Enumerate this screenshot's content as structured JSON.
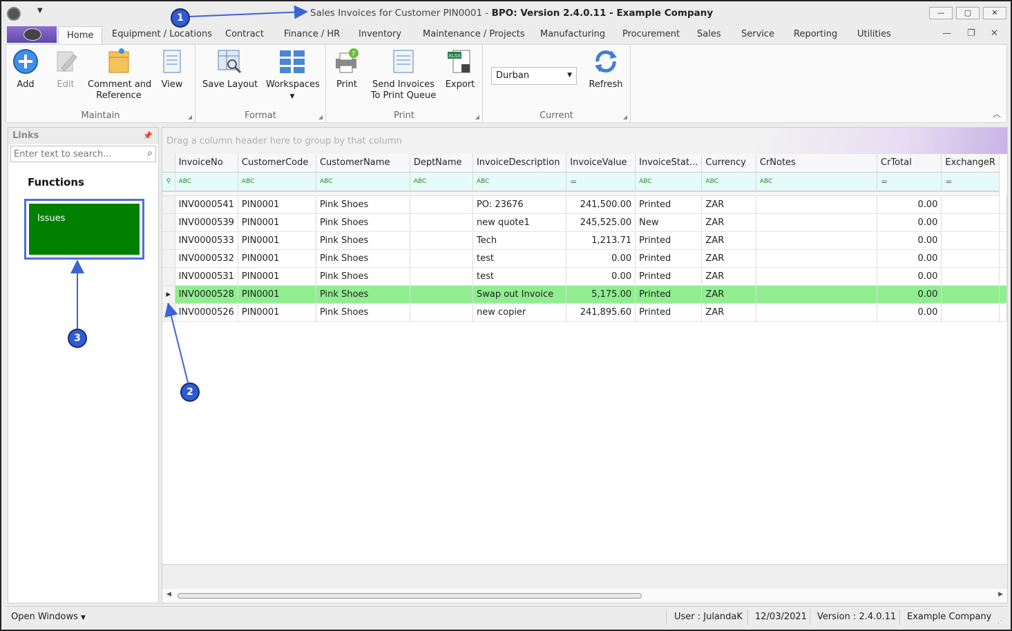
{
  "window": {
    "title_prefix": "Sales Invoices for Customer PIN0001 - ",
    "title_bold": "BPO: Version 2.4.0.11 - Example Company",
    "controls": [
      "—",
      "▢",
      "✕"
    ]
  },
  "tabs": [
    "Home",
    "Equipment / Locations",
    "Contract",
    "Finance / HR",
    "Inventory",
    "Maintenance / Projects",
    "Manufacturing",
    "Procurement",
    "Sales",
    "Service",
    "Reporting",
    "Utilities"
  ],
  "ribbon": {
    "maintain": {
      "label": "Maintain",
      "add": "Add",
      "edit": "Edit",
      "comment_1": "Comment and",
      "comment_2": "Reference",
      "view": "View"
    },
    "format": {
      "label": "Format",
      "save_layout": "Save Layout",
      "workspaces": "Workspaces"
    },
    "print": {
      "label": "Print",
      "print": "Print",
      "send_1": "Send Invoices",
      "send_2": "To Print Queue",
      "export": "Export"
    },
    "current": {
      "label": "Current",
      "site": "Durban",
      "refresh": "Refresh"
    }
  },
  "links": {
    "title": "Links",
    "search_placeholder": "Enter text to search...",
    "functions_title": "Functions",
    "issues_label": "Issues"
  },
  "grid": {
    "group_hint": "Drag a column header here to group by that column",
    "columns": [
      "InvoiceNo",
      "CustomerCode",
      "CustomerName",
      "DeptName",
      "InvoiceDescription",
      "InvoiceValue",
      "InvoiceStat...",
      "Currency",
      "CrNotes",
      "CrTotal",
      "ExchangeR"
    ],
    "rows": [
      {
        "InvoiceNo": "INV0000541",
        "CustomerCode": "PIN0001",
        "CustomerName": "Pink Shoes",
        "DeptName": "",
        "InvoiceDescription": "PO: 23676",
        "InvoiceValue": "241,500.00",
        "InvoiceStatus": "Printed",
        "Currency": "ZAR",
        "CrNotes": "",
        "CrTotal": "0.00",
        "Exchange": ""
      },
      {
        "InvoiceNo": "INV0000539",
        "CustomerCode": "PIN0001",
        "CustomerName": "Pink Shoes",
        "DeptName": "",
        "InvoiceDescription": "new quote1",
        "InvoiceValue": "245,525.00",
        "InvoiceStatus": "New",
        "Currency": "ZAR",
        "CrNotes": "",
        "CrTotal": "0.00",
        "Exchange": ""
      },
      {
        "InvoiceNo": "INV0000533",
        "CustomerCode": "PIN0001",
        "CustomerName": "Pink Shoes",
        "DeptName": "",
        "InvoiceDescription": "Tech",
        "InvoiceValue": "1,213.71",
        "InvoiceStatus": "Printed",
        "Currency": "ZAR",
        "CrNotes": "",
        "CrTotal": "0.00",
        "Exchange": ""
      },
      {
        "InvoiceNo": "INV0000532",
        "CustomerCode": "PIN0001",
        "CustomerName": "Pink Shoes",
        "DeptName": "",
        "InvoiceDescription": "test",
        "InvoiceValue": "0.00",
        "InvoiceStatus": "Printed",
        "Currency": "ZAR",
        "CrNotes": "",
        "CrTotal": "0.00",
        "Exchange": ""
      },
      {
        "InvoiceNo": "INV0000531",
        "CustomerCode": "PIN0001",
        "CustomerName": "Pink Shoes",
        "DeptName": "",
        "InvoiceDescription": "test",
        "InvoiceValue": "0.00",
        "InvoiceStatus": "Printed",
        "Currency": "ZAR",
        "CrNotes": "",
        "CrTotal": "0.00",
        "Exchange": ""
      },
      {
        "InvoiceNo": "INV0000528",
        "CustomerCode": "PIN0001",
        "CustomerName": "Pink Shoes",
        "DeptName": "",
        "InvoiceDescription": "Swap out Invoice",
        "InvoiceValue": "5,175.00",
        "InvoiceStatus": "Printed",
        "Currency": "ZAR",
        "CrNotes": "",
        "CrTotal": "0.00",
        "Exchange": ""
      },
      {
        "InvoiceNo": "INV0000526",
        "CustomerCode": "PIN0001",
        "CustomerName": "Pink Shoes",
        "DeptName": "",
        "InvoiceDescription": "new copier",
        "InvoiceValue": "241,895.60",
        "InvoiceStatus": "Printed",
        "Currency": "ZAR",
        "CrNotes": "",
        "CrTotal": "0.00",
        "Exchange": ""
      }
    ]
  },
  "status": {
    "open_windows": "Open Windows",
    "user": "User : JulandaK",
    "date": "12/03/2021",
    "version": "Version : 2.4.0.11",
    "company": "Example Company"
  },
  "annotations": [
    "1",
    "2",
    "3"
  ],
  "colors": {
    "selected_row": "#90ee90",
    "issues_tile": "#008000",
    "callout": "#2f5bd6"
  }
}
